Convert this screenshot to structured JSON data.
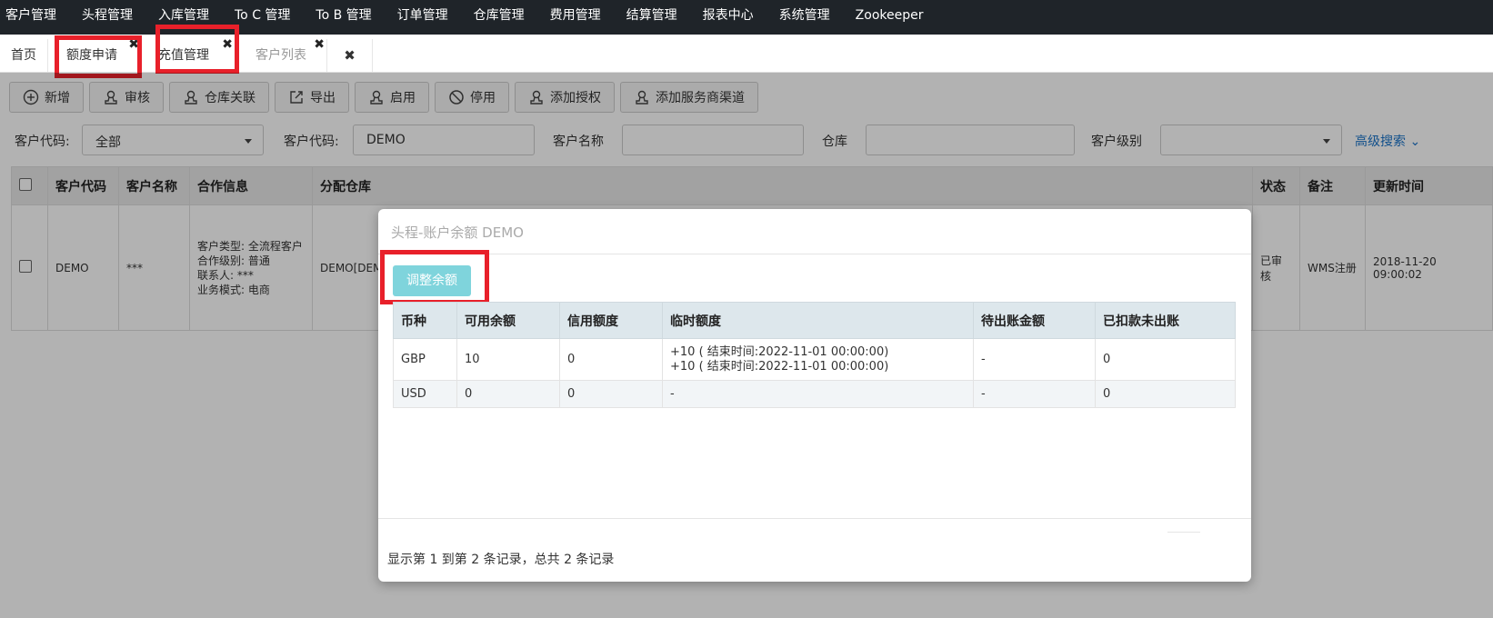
{
  "nav": {
    "items": [
      "客户管理",
      "头程管理",
      "入库管理",
      "To C 管理",
      "To B 管理",
      "订单管理",
      "仓库管理",
      "费用管理",
      "结算管理",
      "报表中心",
      "系统管理",
      "Zookeeper"
    ]
  },
  "tabs": {
    "home": "首页",
    "t1": "额度申请",
    "t2": "充值管理",
    "t3": "客户列表",
    "close_glyph": "✖"
  },
  "toolbar": {
    "add": "新增",
    "review": "审核",
    "warehouse_link": "仓库关联",
    "export": "导出",
    "enable": "启用",
    "disable": "停用",
    "add_auth": "添加授权",
    "add_channel": "添加服务商渠道"
  },
  "filters": {
    "label1": "客户代码:",
    "select1": "全部",
    "label2": "客户代码:",
    "input2": "DEMO",
    "label3": "客户名称",
    "label4": "仓库",
    "label5": "客户级别",
    "advanced": "高级搜索"
  },
  "grid": {
    "headers": [
      "客户代码",
      "客户名称",
      "合作信息",
      "分配仓库",
      "状态",
      "备注",
      "更新时间"
    ],
    "row": {
      "code": "DEMO",
      "name": "***",
      "coop": [
        "客户类型: 全流程客户",
        "合作级别: 普通",
        "联系人: ***",
        "业务模式: 电商"
      ],
      "warehouse": "DEMO[DEM",
      "status": "已审核",
      "remark": "WMS注册",
      "updated": "2018-11-20 09:00:02"
    }
  },
  "modal": {
    "title": "头程-账户余额 DEMO",
    "adjust_button": "调整余额",
    "headers": [
      "币种",
      "可用余额",
      "信用额度",
      "临时额度",
      "待出账金额",
      "已扣款未出账"
    ],
    "rows": [
      {
        "currency": "GBP",
        "available": "10",
        "credit": "0",
        "temp": [
          "+10 ( 结束时间:2022-11-01 00:00:00)",
          "+10 ( 结束时间:2022-11-01 00:00:00)"
        ],
        "pending": "-",
        "deducted": "0"
      },
      {
        "currency": "USD",
        "available": "0",
        "credit": "0",
        "temp": [
          "-"
        ],
        "pending": "-",
        "deducted": "0"
      }
    ],
    "record_info": "显示第 1 到第 2 条记录，总共 2 条记录"
  },
  "colors": {
    "nav_bg": "#1f2429",
    "highlight_red": "#e8202a",
    "adjust_btn": "#7fd4dc",
    "link_blue": "#1a73c8"
  }
}
